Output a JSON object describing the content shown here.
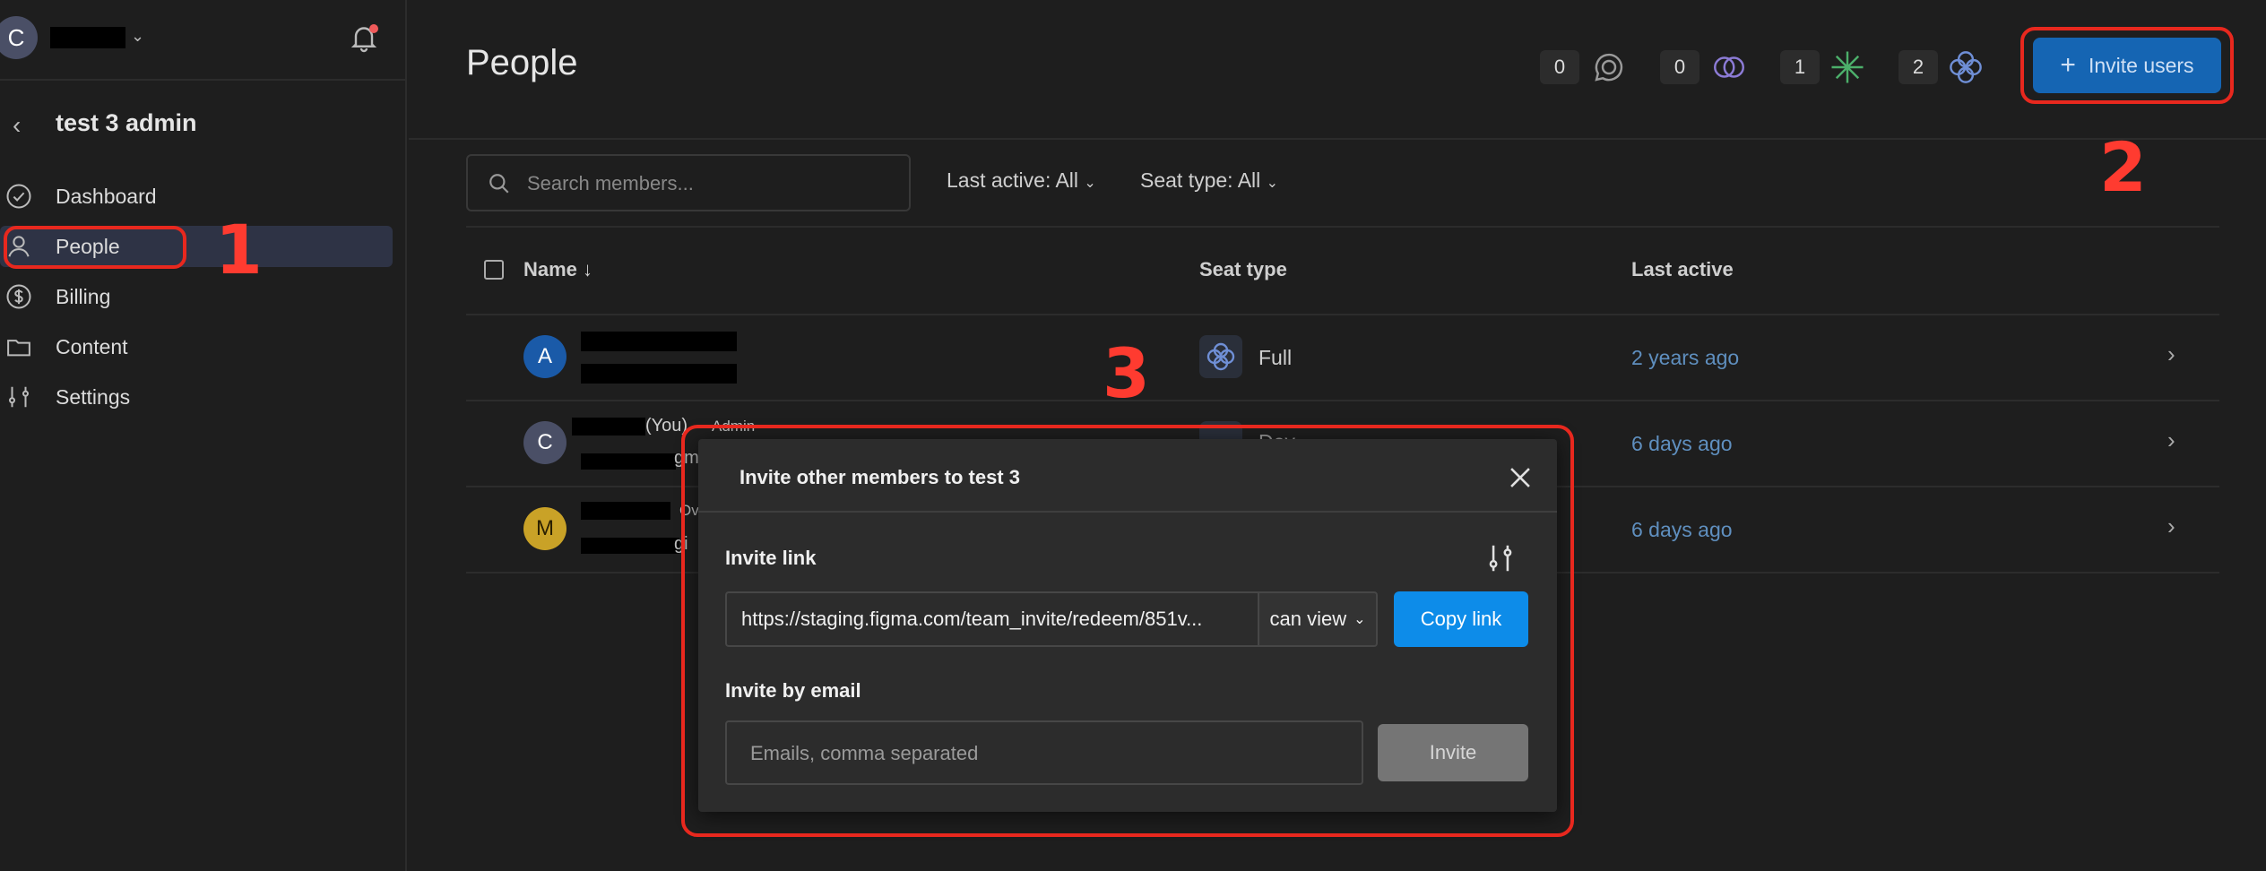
{
  "sidebar": {
    "account_initial": "C",
    "team_name": "test 3 admin",
    "items": [
      {
        "label": "Dashboard",
        "icon": "check-circle-icon"
      },
      {
        "label": "People",
        "icon": "person-icon",
        "active": true
      },
      {
        "label": "Billing",
        "icon": "dollar-circle-icon"
      },
      {
        "label": "Content",
        "icon": "folder-icon"
      },
      {
        "label": "Settings",
        "icon": "sliders-icon"
      }
    ]
  },
  "header": {
    "title": "People",
    "seat_counts": [
      "0",
      "0",
      "1",
      "2"
    ],
    "invite_label": "Invite users"
  },
  "filters": {
    "search_placeholder": "Search members...",
    "last_active": "Last active: All",
    "seat_type": "Seat type: All"
  },
  "table": {
    "columns": [
      "Name ↓",
      "Seat type",
      "Last active"
    ],
    "rows": [
      {
        "initial": "A",
        "avatar_color": "#1a5aa8",
        "seat": "Full",
        "last_active": "2 years ago"
      },
      {
        "initial": "C",
        "avatar_color": "#4a4f66",
        "you": "(You)",
        "role": "Admin",
        "name_fragment": "gm",
        "seat": "Dev",
        "last_active": "6 days ago"
      },
      {
        "initial": "M",
        "avatar_color": "#c9a227",
        "role": "Ov",
        "name_fragment": "gi",
        "last_active": "6 days ago"
      }
    ]
  },
  "modal": {
    "title": "Invite other members to test 3",
    "link_label": "Invite link",
    "link_value": "https://staging.figma.com/team_invite/redeem/851v...",
    "permission": "can view",
    "copy_label": "Copy link",
    "email_label": "Invite by email",
    "email_placeholder": "Emails, comma separated",
    "invite_label": "Invite"
  },
  "annotations": [
    "1",
    "2",
    "3"
  ],
  "colors": {
    "accent": "#0d8ce9",
    "invite_button": "#1565b3",
    "annotation": "#e8281e",
    "link": "#5f8fbf"
  }
}
